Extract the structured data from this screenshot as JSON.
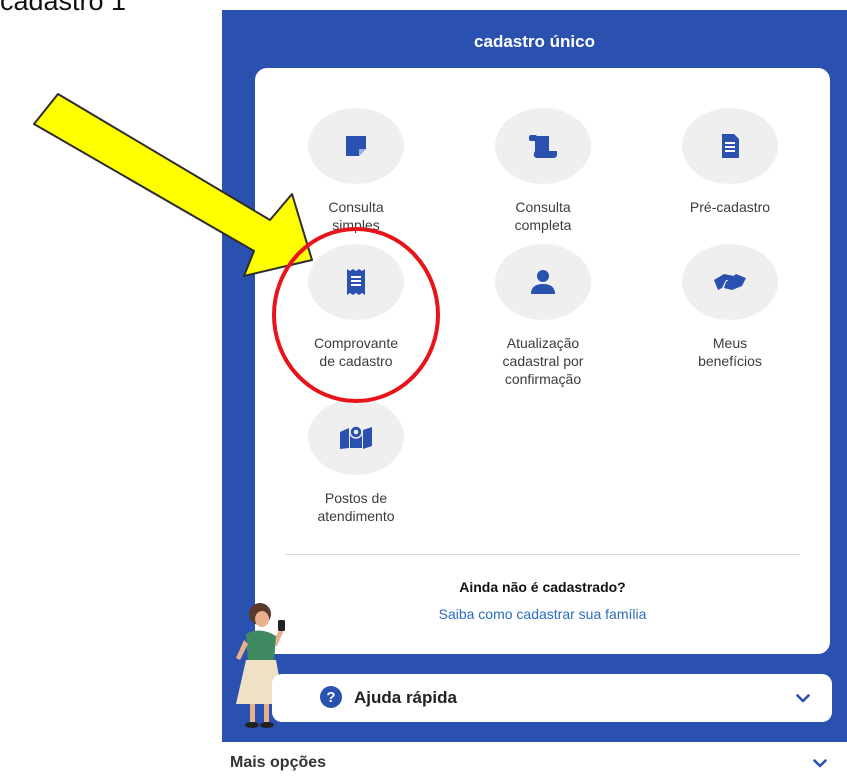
{
  "doc_label": "cadastro 1",
  "app": {
    "title": "cadastro único"
  },
  "tiles": [
    {
      "label": "Consulta\nsimples",
      "icon": "note-icon"
    },
    {
      "label": "Consulta\ncompleta",
      "icon": "scroll-icon"
    },
    {
      "label": "Pré-cadastro",
      "icon": "document-icon"
    },
    {
      "label": "Comprovante\nde cadastro",
      "icon": "receipt-icon"
    },
    {
      "label": "Atualização\ncadastral por\nconfirmação",
      "icon": "person-icon"
    },
    {
      "label": "Meus\nbenefícios",
      "icon": "handshake-icon"
    },
    {
      "label": "Postos de\natendimento",
      "icon": "map-pin-icon"
    }
  ],
  "not_registered": {
    "question": "Ainda não é cadastrado?",
    "link": "Saiba como cadastrar sua família"
  },
  "quick_help": {
    "label": "Ajuda rápida",
    "icon_glyph": "?"
  },
  "more_options": {
    "label": "Mais opções"
  },
  "colors": {
    "brand_blue": "#2a50b0",
    "link_blue": "#2a6dbd",
    "annotation_arrow": "#ffff00",
    "annotation_circle": "#e8141b"
  }
}
